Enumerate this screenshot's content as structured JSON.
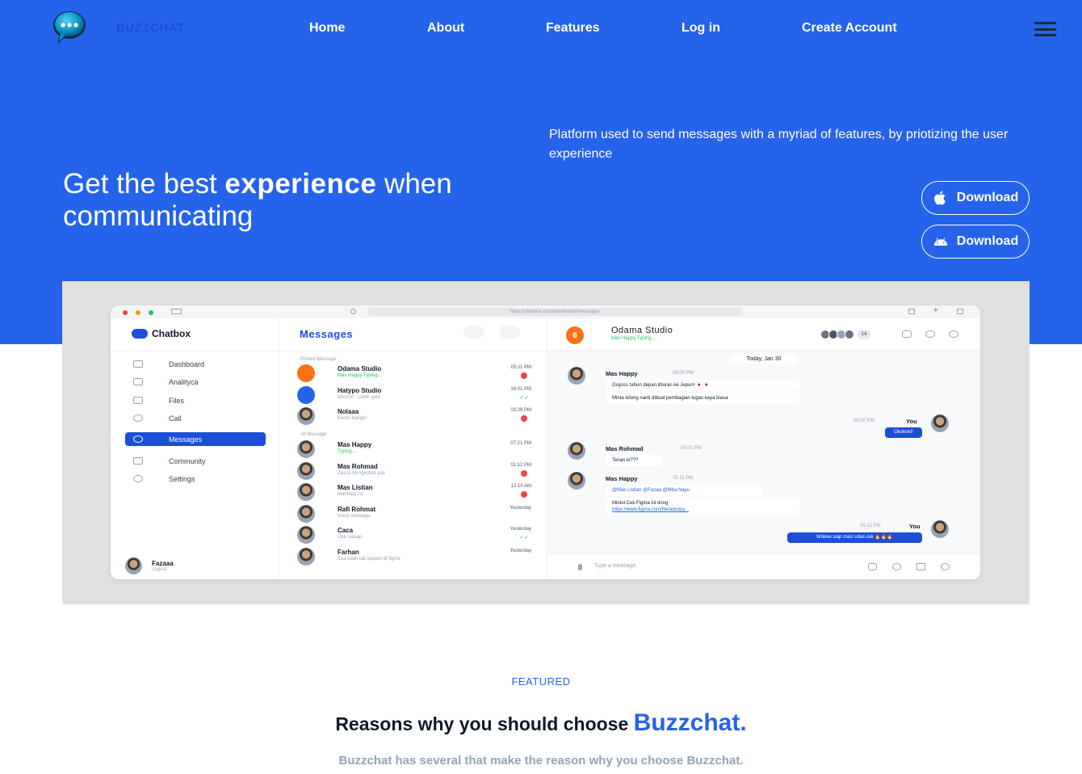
{
  "nav": {
    "brand": "BUZZCHAT",
    "links": [
      "Home",
      "About",
      "Features",
      "Log in",
      "Create Account"
    ]
  },
  "hero": {
    "title_pre": "Get the best ",
    "title_bold": "experience",
    "title_post": " when communicating",
    "description": "Platform used to send messages with a myriad of features, by priotizing the user experience",
    "download_ios": "Download",
    "download_android": "Download"
  },
  "mockup": {
    "url": "https://chatbox.com/dashboard/messages",
    "sidebar": {
      "brand": "Chatbox",
      "items": [
        "Dashboard",
        "Analityca",
        "Files",
        "Call",
        "Messages",
        "Community",
        "Settings"
      ],
      "active_index": 4,
      "user_name": "Fazaaa",
      "user_sub": "Logout"
    },
    "messages": {
      "title": "Messages",
      "pinned_label": "Pinned Message",
      "all_label": "All Message",
      "pinned": [
        {
          "name": "Odama Studio",
          "preview": "Mas Happy Typing...",
          "time": "05:11 PM",
          "status": "badge",
          "typing": true
        },
        {
          "name": "Hatypo Studio",
          "preview": "Momon : Lebih gaul",
          "time": "16:01 PM",
          "status": "check",
          "typing": false
        },
        {
          "name": "Nolaaa",
          "preview": "Keren banget",
          "time": "03:29 PM",
          "status": "badge",
          "typing": false
        }
      ],
      "all": [
        {
          "name": "Mas Happy",
          "preview": "Typing...",
          "time": "07:21 PM",
          "status": "none",
          "typing": true
        },
        {
          "name": "Mas Rohmad",
          "preview": "Zea jo bli ngechat yaa",
          "time": "01:12 PM",
          "status": "badge",
          "typing": false
        },
        {
          "name": "Mas Listian",
          "preview": "Mantapp za",
          "time": "12:10 AM",
          "status": "badge",
          "typing": false
        },
        {
          "name": "Rafi Rohmat",
          "preview": "Voice message",
          "time": "Yesterday",
          "status": "none",
          "typing": false
        },
        {
          "name": "Caca",
          "preview": "Oke siaaap",
          "time": "Yesterday",
          "status": "check",
          "typing": false
        },
        {
          "name": "Farhan",
          "preview": "Zea udah tak update di figma",
          "time": "Yesterday",
          "status": "none",
          "typing": false
        }
      ]
    },
    "chat": {
      "name": "Odama Studio",
      "typing": "Mas Happy Typing....",
      "group_count": "14",
      "date": "Today, Jan 30",
      "sender1": "Mas Happy",
      "time1": "05:00 PM",
      "msg1a": "Guysss tahun depan liburan ke Jepun! 🇯🇵 🇯🇵",
      "msg1b": "Minta tolong nanti dibuat pembagian tugas kaya biasa",
      "you_label": "You",
      "time_you1": "05:02 PM",
      "msg_you1": "Okokok!!",
      "sender2": "Mas Rohmad",
      "time2": "05:01 PM",
      "msg2": "Tenan ki???",
      "sender3": "Mas Happy",
      "time3": "05:11 PM",
      "mentions": "@Mas Listian  @Fazaa  @Mba Nayu",
      "msg3": "Mintol Cek Figma ini dong",
      "msg3_link": "https://www.figma.com/file/adcopy...",
      "time_you2": "05:12 PM",
      "msg_you2": "Wokee siap mas! utiwi cek 🔥🔥🔥",
      "placeholder": "Type a message"
    }
  },
  "featured": {
    "label": "FEATURED",
    "title_pre": "Reasons why you should choose ",
    "title_brand": "Buzzchat.",
    "subtitle": "Buzzchat has several that make the reason why you choose Buzzchat."
  },
  "colors": {
    "primary": "#2563eb",
    "mockup_bg": "#e0e0e0",
    "accent_dark": "#1d4ed8"
  }
}
